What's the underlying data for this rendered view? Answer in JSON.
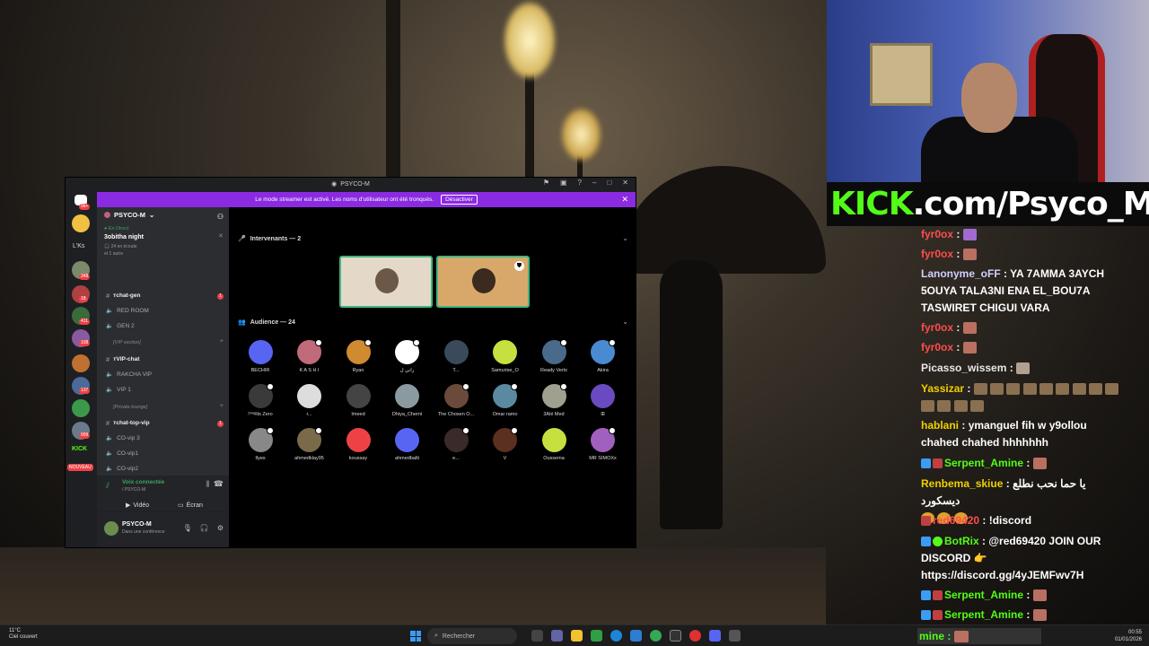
{
  "discord": {
    "window_title": "PSYCO-M",
    "banner": {
      "text": "Le mode streamer est activé. Les noms d'utilisateur ont été tronqués.",
      "button": "Désactiver"
    },
    "server_badges": [
      "9k+",
      "348",
      "18",
      "411",
      "108",
      "137",
      "999"
    ],
    "lks_label": "L'Ks",
    "nouveau_label": "NOUVEAU",
    "guild_name": "PSYCO-M",
    "event": {
      "live": "En Direct",
      "title": "3obitha night",
      "listeners": "24 en écoute",
      "others": "et 1 autre"
    },
    "channels": [
      {
        "label": "тchat-gen",
        "badge": "1"
      },
      {
        "label": "RED ROOM"
      },
      {
        "label": "GEN 2"
      },
      {
        "category": "[VIP section]"
      },
      {
        "label": "тVIP-chat"
      },
      {
        "label": "RAKCHA VIP"
      },
      {
        "label": "VIP 1"
      },
      {
        "category": "[Private lounge]"
      },
      {
        "label": "тchat-top-vip",
        "badge": "1"
      },
      {
        "label": "CO-vip 3"
      },
      {
        "label": "CO-vip1"
      },
      {
        "label": "CO-vip2"
      }
    ],
    "voice": {
      "connected": "Voix connectée",
      "sub": "/ PSYCO-M",
      "video": "Vidéo",
      "screen": "Écran"
    },
    "user": {
      "name": "PSYCO-M",
      "status": "Dans une conférence"
    },
    "stage": {
      "speakers_header": "Intervenants — 2",
      "audience_header": "Audience — 24",
      "audience": [
        "BECHIR",
        "K A S H I",
        "Ryan",
        "راني ل",
        "T...",
        "Samurise_O",
        "Ready Vertx",
        "Akira",
        "!ᵐᵃᵍIts Zero",
        "r...",
        "Imeed",
        "Dhiya_Cherni",
        "The Chosen O...",
        "Omar ramo",
        "3Alé Med",
        "ꕥ",
        "Ilyes",
        "ahmedklay95",
        "koussay",
        "ahmedbalti",
        "e...",
        "V",
        "Oussema",
        "MR SIMOXx"
      ]
    }
  },
  "kick_banner": {
    "kick": "KICK",
    "rest": ".com/Psyco_M"
  },
  "chat": [
    {
      "user": "fyr0ox",
      "text": ""
    },
    {
      "user": "fyr0ox",
      "text": ""
    },
    {
      "user": "Lanonyme_oFF",
      "text": "YA 7AMMA 3AYCH 5OUYA TALA3NI ENA EL_BOU7A TASWIRET CHIGUI VARA"
    },
    {
      "user": "fyr0ox",
      "text": ""
    },
    {
      "user": "fyr0ox",
      "text": ""
    },
    {
      "user": "Picasso_wissem",
      "text": ""
    },
    {
      "user": "Yassizar",
      "text": ""
    },
    {
      "user": "hablani",
      "text": "ymanguel fih w y9ollou chahed chahed hhhhhhh"
    },
    {
      "user": "Serpent_Amine",
      "text": ""
    },
    {
      "user": "Renbema_skiue",
      "text": "يا حما نحب نطلع ديسكورد"
    },
    {
      "user": "red69420",
      "text": "!discord"
    },
    {
      "user": "BotRix",
      "text": "@red69420 JOIN OUR DISCORD 👉 https://discord.gg/4yJEMFwv7H"
    },
    {
      "user": "Serpent_Amine",
      "text": ""
    },
    {
      "user": "Serpent_Amine",
      "text": ""
    }
  ],
  "chat_input": "mine :",
  "taskbar": {
    "temp": "11°C",
    "weather": "Ciel couvert",
    "search": "Rechercher",
    "time": "00:55",
    "date": "01/01/2026"
  }
}
